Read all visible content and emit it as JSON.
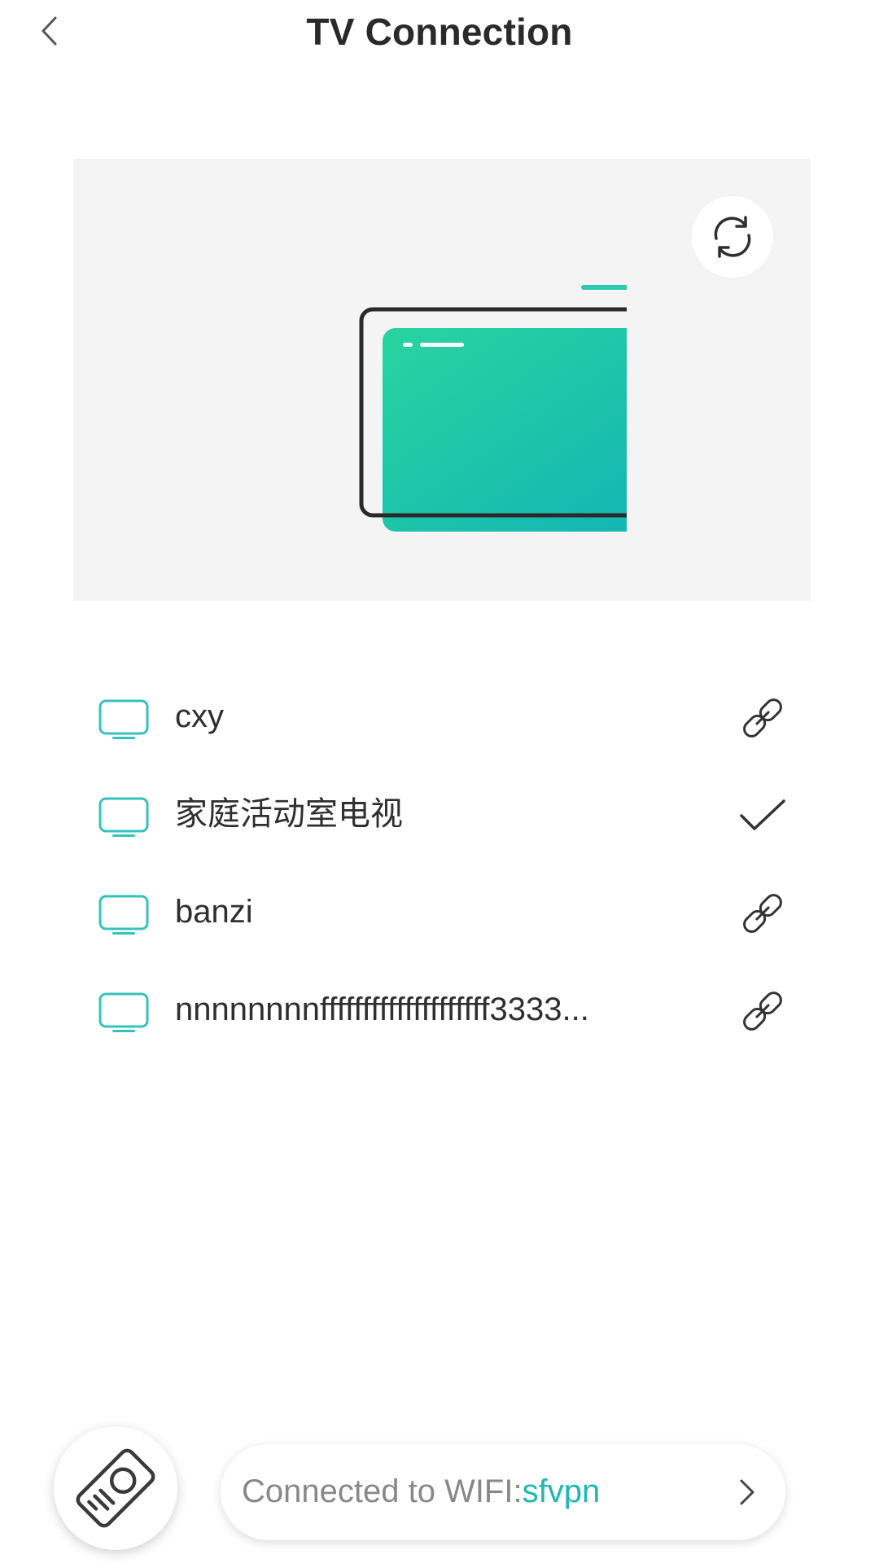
{
  "header": {
    "title": "TV Connection",
    "back_icon": "chevron-left-icon"
  },
  "preview": {
    "refresh_icon": "refresh-icon",
    "illustration": "tv-illustration"
  },
  "devices": [
    {
      "name": "cxy",
      "status_icon": "link-icon",
      "connected": false
    },
    {
      "name": "家庭活动室电视",
      "status_icon": "check-icon",
      "connected": true
    },
    {
      "name": "banzi",
      "status_icon": "link-icon",
      "connected": false
    },
    {
      "name": "nnnnnnnnffffffffffffffffffff3333...",
      "status_icon": "link-icon",
      "connected": false
    }
  ],
  "footer": {
    "remote_icon": "remote-control-icon",
    "wifi_prefix": "Connected to WIFI:",
    "wifi_name": "sfvpn",
    "chevron_icon": "chevron-right-icon"
  },
  "colors": {
    "accent": "#1fb8b0",
    "tv_gradient_start": "#2ad4a0",
    "tv_gradient_end": "#12b3b5",
    "panel_bg": "#f4f4f4",
    "text_dark": "#2f2f2f",
    "text_muted": "#888888"
  }
}
